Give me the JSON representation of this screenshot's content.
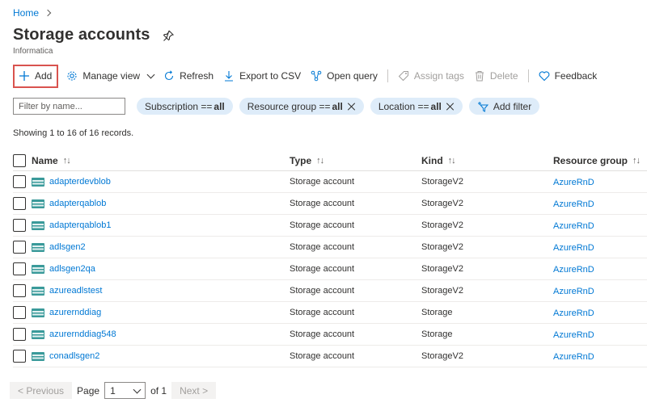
{
  "breadcrumb": {
    "home": "Home"
  },
  "page": {
    "title": "Storage accounts",
    "subtitle": "Informatica"
  },
  "toolbar": {
    "add": "Add",
    "manage_view": "Manage view",
    "refresh": "Refresh",
    "export": "Export to CSV",
    "open_query": "Open query",
    "assign_tags": "Assign tags",
    "delete": "Delete",
    "feedback": "Feedback"
  },
  "filters": {
    "placeholder": "Filter by name...",
    "subscription": {
      "label": "Subscription == ",
      "value": "all"
    },
    "resource_group": {
      "label": "Resource group == ",
      "value": "all"
    },
    "location": {
      "label": "Location == ",
      "value": "all"
    },
    "add_filter": "Add filter"
  },
  "records_text": "Showing 1 to 16 of 16 records.",
  "table": {
    "columns": {
      "name": "Name",
      "type": "Type",
      "kind": "Kind",
      "resource_group": "Resource group",
      "sort_glyph": "↑↓"
    },
    "rows": [
      {
        "name": "adapterdevblob",
        "type": "Storage account",
        "kind": "StorageV2",
        "rg": "AzureRnD"
      },
      {
        "name": "adapterqablob",
        "type": "Storage account",
        "kind": "StorageV2",
        "rg": "AzureRnD"
      },
      {
        "name": "adapterqablob1",
        "type": "Storage account",
        "kind": "StorageV2",
        "rg": "AzureRnD"
      },
      {
        "name": "adlsgen2",
        "type": "Storage account",
        "kind": "StorageV2",
        "rg": "AzureRnD"
      },
      {
        "name": "adlsgen2qa",
        "type": "Storage account",
        "kind": "StorageV2",
        "rg": "AzureRnD"
      },
      {
        "name": "azureadlstest",
        "type": "Storage account",
        "kind": "StorageV2",
        "rg": "AzureRnD"
      },
      {
        "name": "azurernddiag",
        "type": "Storage account",
        "kind": "Storage",
        "rg": "AzureRnD"
      },
      {
        "name": "azurernddiag548",
        "type": "Storage account",
        "kind": "Storage",
        "rg": "AzureRnD"
      },
      {
        "name": "conadlsgen2",
        "type": "Storage account",
        "kind": "StorageV2",
        "rg": "AzureRnD"
      }
    ]
  },
  "pager": {
    "previous": "< Previous",
    "page_label": "Page",
    "page_value": "1",
    "of_label": "of 1",
    "next": "Next >"
  },
  "icons": {
    "add": "plus-icon",
    "manage_view": "gear-icon",
    "refresh": "refresh-icon",
    "export": "download-icon",
    "open_query": "query-icon",
    "assign_tags": "tag-icon",
    "delete": "trash-icon",
    "feedback": "heart-icon",
    "pin": "pin-icon",
    "add_filter": "filter-add-icon",
    "storage": "storage-account-icon"
  },
  "colors": {
    "accent": "#0078d4",
    "pill_bg": "#deecf9",
    "highlight": "#d9534f",
    "storage_icon": "#3a9a9a"
  }
}
